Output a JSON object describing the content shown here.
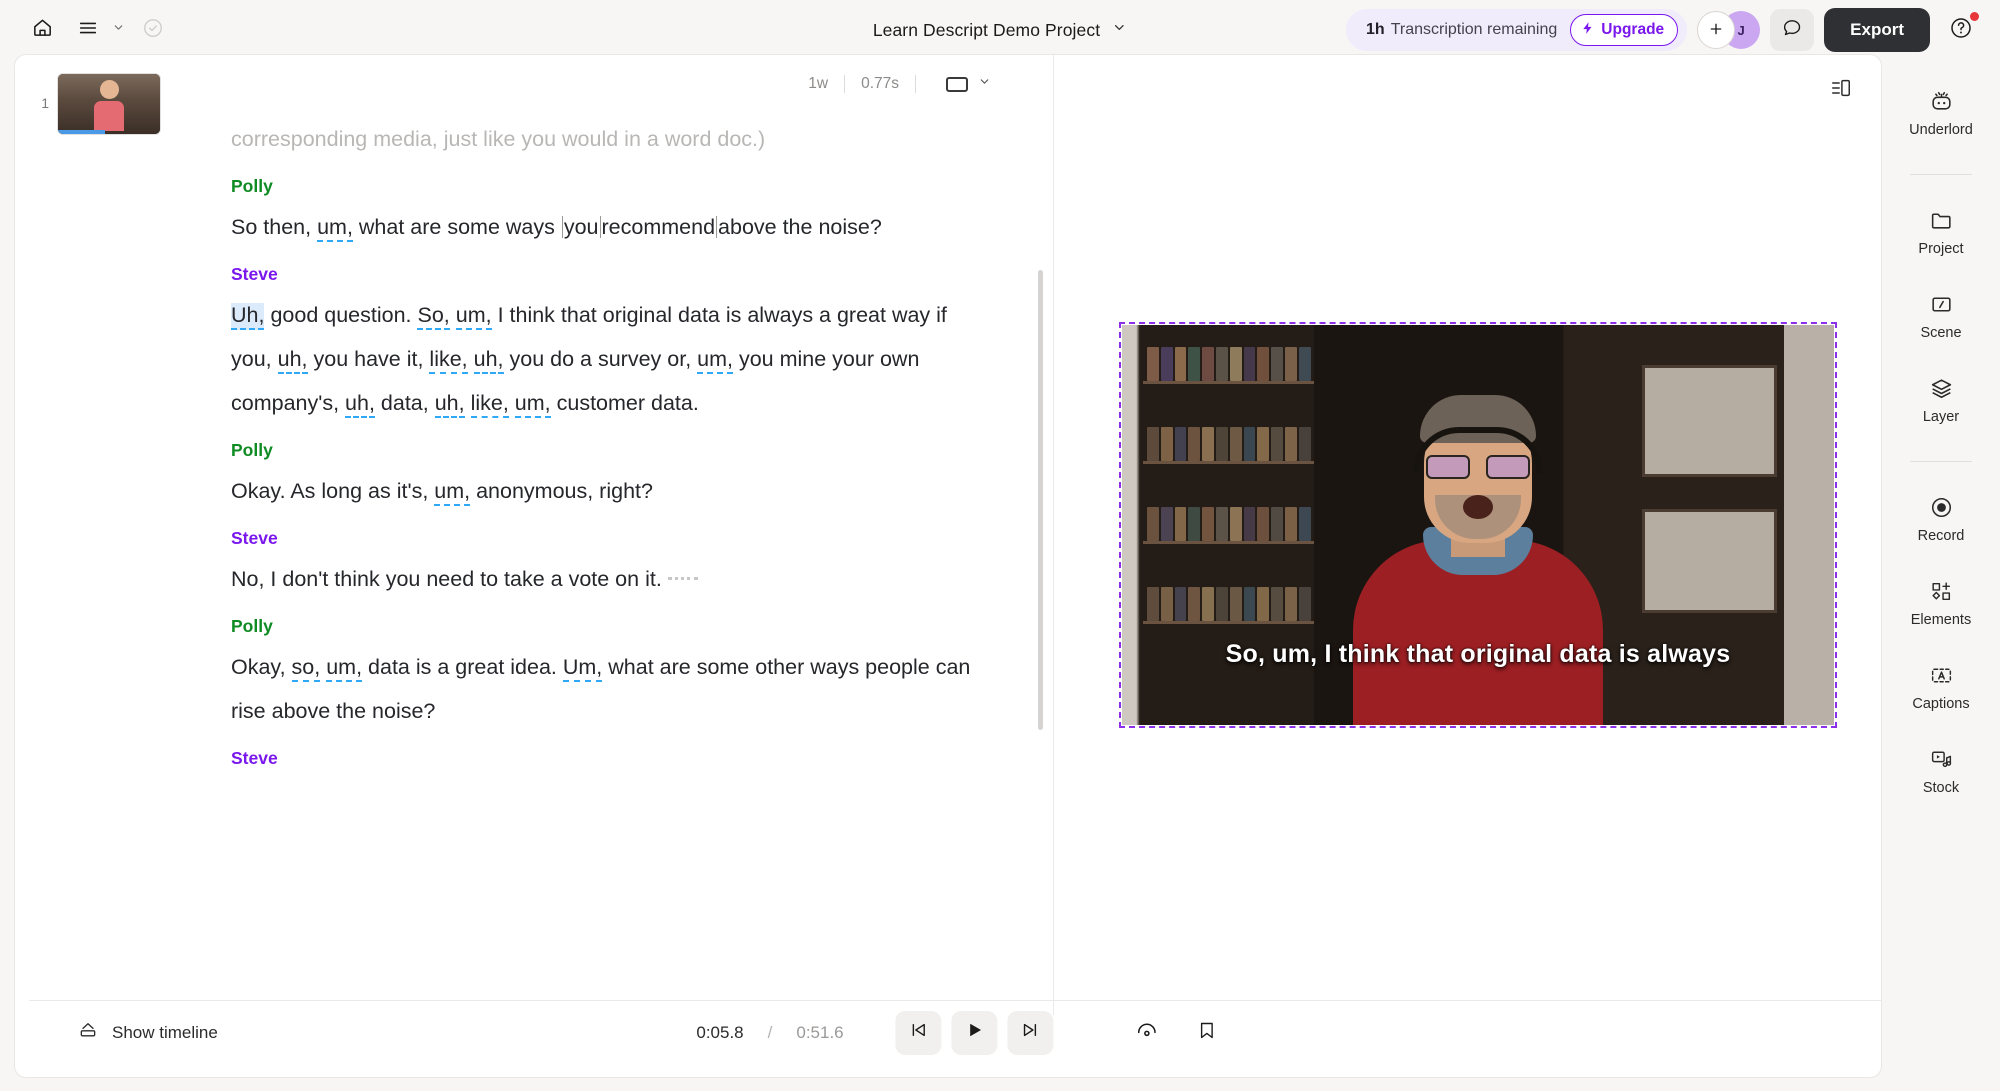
{
  "topbar": {
    "home_icon": "home-icon",
    "menu_icon": "hamburger-menu-icon",
    "checkmark_icon": "check-circle-icon",
    "project_title": "Learn Descript Demo Project",
    "title_chevron": "chevron-down-icon",
    "transcription_hours": "1h",
    "transcription_label": "Transcription remaining",
    "upgrade_label": "Upgrade",
    "upgrade_icon": "lightning-bolt-icon",
    "add_collaborator_icon": "plus-icon",
    "avatar_initial": "J",
    "comment_icon": "comment-bubble-icon",
    "export_label": "Export",
    "help_icon": "question-mark-circle-icon",
    "accent_purple": "#7a17ed",
    "export_bg": "#2f3033",
    "notification_dot": "#e8353a"
  },
  "doc_toolbar": {
    "word_count": "1w",
    "duration": "0.77s",
    "aspect_icon": "rectangle-icon",
    "aspect_chevron": "chevron-down-icon",
    "layout_icon": "split-layout-icon"
  },
  "thumbnails": [
    {
      "number": "1",
      "name": "scene-thumbnail"
    }
  ],
  "transcript": {
    "paragraphs": [
      {
        "speaker": null,
        "faded": true,
        "tokens": [
          {
            "t": "corresponding media, just like you would in a word doc.)",
            "k": "plain"
          }
        ]
      },
      {
        "speaker": "Polly",
        "speaker_color": "#0f8b23",
        "tokens": [
          {
            "t": "So then, ",
            "k": "plain"
          },
          {
            "t": "um,",
            "k": "filler"
          },
          {
            "t": " what are some ways ",
            "k": "plain"
          },
          {
            "t": "|",
            "k": "cursor"
          },
          {
            "t": "you",
            "k": "plain"
          },
          {
            "t": "|",
            "k": "cursor"
          },
          {
            "t": "recommend",
            "k": "plain"
          },
          {
            "t": "|",
            "k": "cursor"
          },
          {
            "t": "above the noise?",
            "k": "plain"
          }
        ]
      },
      {
        "speaker": "Steve",
        "speaker_color": "#7a17ed",
        "tokens": [
          {
            "t": "Uh,",
            "k": "filler-selected"
          },
          {
            "t": " good question. ",
            "k": "plain"
          },
          {
            "t": "So,",
            "k": "filler"
          },
          {
            "t": " ",
            "k": "plain"
          },
          {
            "t": "um,",
            "k": "filler"
          },
          {
            "t": " I think that original data is always a great way if you, ",
            "k": "plain"
          },
          {
            "t": "uh,",
            "k": "filler"
          },
          {
            "t": " you have it, ",
            "k": "plain"
          },
          {
            "t": "like,",
            "k": "filler"
          },
          {
            "t": " ",
            "k": "plain"
          },
          {
            "t": "uh,",
            "k": "filler"
          },
          {
            "t": " you do a survey or, ",
            "k": "plain"
          },
          {
            "t": "um,",
            "k": "filler"
          },
          {
            "t": " you mine your own company's, ",
            "k": "plain"
          },
          {
            "t": "uh,",
            "k": "filler"
          },
          {
            "t": " data, ",
            "k": "plain"
          },
          {
            "t": "uh,",
            "k": "filler"
          },
          {
            "t": " ",
            "k": "plain"
          },
          {
            "t": "like,",
            "k": "filler"
          },
          {
            "t": " ",
            "k": "plain"
          },
          {
            "t": "um,",
            "k": "filler"
          },
          {
            "t": " customer data.",
            "k": "plain"
          }
        ]
      },
      {
        "speaker": "Polly",
        "speaker_color": "#0f8b23",
        "tokens": [
          {
            "t": "Okay. As long as it's, ",
            "k": "plain"
          },
          {
            "t": "um,",
            "k": "filler"
          },
          {
            "t": " anonymous, right?",
            "k": "plain"
          }
        ]
      },
      {
        "speaker": "Steve",
        "speaker_color": "#7a17ed",
        "tokens": [
          {
            "t": "No, I don't think you need to take a vote on it.",
            "k": "plain"
          },
          {
            "t": "",
            "k": "gap"
          }
        ]
      },
      {
        "speaker": "Polly",
        "speaker_color": "#0f8b23",
        "tokens": [
          {
            "t": "Okay, ",
            "k": "plain"
          },
          {
            "t": "so,",
            "k": "filler"
          },
          {
            "t": " ",
            "k": "plain"
          },
          {
            "t": "um,",
            "k": "filler"
          },
          {
            "t": " data is a great idea. ",
            "k": "plain"
          },
          {
            "t": "Um,",
            "k": "filler"
          },
          {
            "t": " what are some other ways people can rise above the noise?",
            "k": "plain"
          }
        ]
      },
      {
        "speaker": "Steve",
        "speaker_color": "#7a17ed",
        "partial": true,
        "tokens": []
      }
    ],
    "filler_underline_color": "#2fa8f5",
    "selection_color": "#dcebfb"
  },
  "preview": {
    "caption_text": "So, um, I think that original data is always",
    "selection_border_color": "#8b2fe8"
  },
  "player": {
    "show_timeline_label": "Show timeline",
    "show_timeline_icon": "timeline-expand-icon",
    "current_time": "0:05.8",
    "separator": "/",
    "total_time": "0:51.6",
    "skip_back_icon": "skip-to-start-icon",
    "play_icon": "play-icon",
    "skip_forward_icon": "skip-to-end-icon",
    "speed_icon": "playback-speed-icon",
    "bookmark_icon": "bookmark-icon"
  },
  "rail": {
    "items": [
      {
        "label": "Underlord",
        "icon": "robot-icon"
      },
      {
        "label": "Project",
        "icon": "folder-icon"
      },
      {
        "label": "Scene",
        "icon": "scene-slash-icon"
      },
      {
        "label": "Layer",
        "icon": "layers-icon"
      },
      {
        "label": "Record",
        "icon": "record-circle-icon"
      },
      {
        "label": "Elements",
        "icon": "shapes-plus-icon"
      },
      {
        "label": "Captions",
        "icon": "caption-a-icon"
      },
      {
        "label": "Stock",
        "icon": "stock-media-icon"
      }
    ]
  }
}
